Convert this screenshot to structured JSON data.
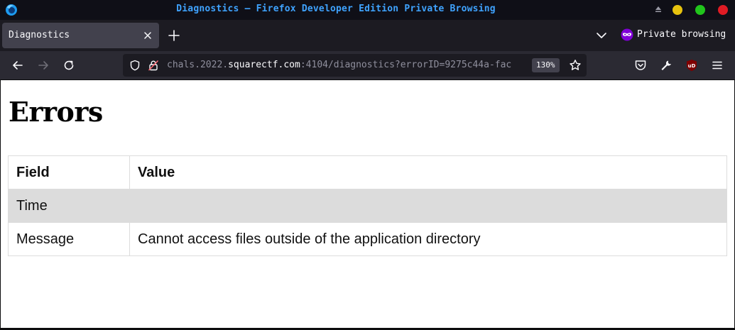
{
  "window": {
    "title": "Diagnostics — Firefox Developer Edition Private Browsing"
  },
  "tabs": [
    {
      "label": "Diagnostics",
      "active": true
    }
  ],
  "tabbar": {
    "private_label": "Private browsing"
  },
  "urlbar": {
    "prefix": "chals.2022.",
    "domain": "squarectf.com",
    "suffix": ":4104/diagnostics?errorID=9275c44a-fac",
    "zoom": "130%"
  },
  "page": {
    "heading": "Errors",
    "table": {
      "headers": [
        "Field",
        "Value"
      ],
      "rows": [
        {
          "field": "Time",
          "value": ""
        },
        {
          "field": "Message",
          "value": "Cannot access files outside of the application directory"
        }
      ]
    }
  },
  "colors": {
    "title_text": "#3fa3ff",
    "titlebar_bg": "#0f0f17",
    "tabbar_bg": "#1c1b22",
    "active_tab_bg": "#42414d",
    "navbar_bg": "#2b2a33",
    "private_purple": "#8000d7",
    "ublock_red": "#800000",
    "row_shade": "#dcdcdc"
  },
  "icons": {
    "app": "firefox-developer-logo-icon",
    "tab_close": "close-icon",
    "new_tab": "plus-icon",
    "tab_list": "chevron-down-icon",
    "private": "private-mask-icon",
    "back": "back-arrow-icon",
    "forward": "forward-arrow-icon",
    "reload": "reload-icon",
    "tracking": "shield-icon",
    "security": "insecure-lock-icon",
    "bookmark": "star-icon",
    "pocket": "pocket-icon",
    "devtools": "wrench-icon",
    "ublock": "ublock-origin-icon",
    "menu": "hamburger-menu-icon"
  }
}
